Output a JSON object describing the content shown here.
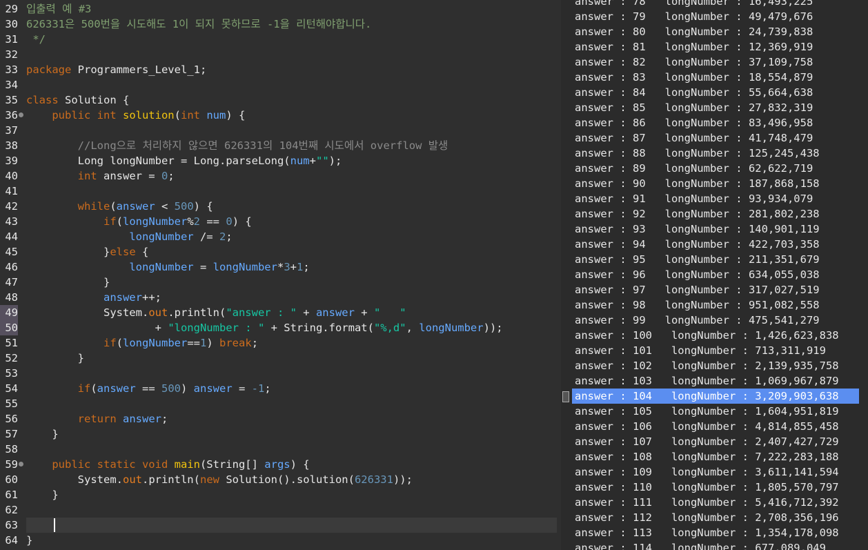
{
  "editor": {
    "lines": [
      {
        "n": "29",
        "tokens": [
          [
            "t-com",
            "입출력 예 #3"
          ]
        ]
      },
      {
        "n": "30",
        "tokens": [
          [
            "t-com",
            "626331은 500번을 시도해도 1이 되지 못하므로 -1을 리턴해야합니다."
          ]
        ]
      },
      {
        "n": "31",
        "tokens": [
          [
            "t-com",
            " */"
          ]
        ]
      },
      {
        "n": "32",
        "tokens": []
      },
      {
        "n": "33",
        "tokens": [
          [
            "t-kw",
            "package"
          ],
          [
            "t-txt",
            " Programmers_Level_1;"
          ]
        ]
      },
      {
        "n": "34",
        "tokens": []
      },
      {
        "n": "35",
        "tokens": [
          [
            "t-kw",
            "class"
          ],
          [
            "t-txt",
            " Solution {"
          ]
        ]
      },
      {
        "n": "36",
        "fold": true,
        "tokens": [
          [
            "t-txt",
            "    "
          ],
          [
            "t-kw",
            "public int "
          ],
          [
            "t-mth",
            "solution"
          ],
          [
            "t-txt",
            "("
          ],
          [
            "t-kw",
            "int "
          ],
          [
            "t-var",
            "num"
          ],
          [
            "t-txt",
            ") {"
          ]
        ]
      },
      {
        "n": "37",
        "tokens": []
      },
      {
        "n": "38",
        "tokens": [
          [
            "t-txt",
            "        "
          ],
          [
            "t-cmt",
            "//Long으로 처리하지 않으면 626331의 104번째 시도에서 overflow 발생"
          ]
        ]
      },
      {
        "n": "39",
        "tokens": [
          [
            "t-txt",
            "        Long "
          ],
          [
            "t-txt",
            "longNumber = Long."
          ],
          [
            "t-txt",
            "parseLong("
          ],
          [
            "t-var",
            "num"
          ],
          [
            "t-txt",
            "+"
          ],
          [
            "t-str",
            "\"\""
          ],
          [
            "t-txt",
            ");"
          ]
        ]
      },
      {
        "n": "40",
        "tokens": [
          [
            "t-txt",
            "        "
          ],
          [
            "t-kw",
            "int"
          ],
          [
            "t-txt",
            " answer = "
          ],
          [
            "t-num",
            "0"
          ],
          [
            "t-txt",
            ";"
          ]
        ]
      },
      {
        "n": "41",
        "tokens": []
      },
      {
        "n": "42",
        "tokens": [
          [
            "t-txt",
            "        "
          ],
          [
            "t-kw",
            "while"
          ],
          [
            "t-txt",
            "("
          ],
          [
            "t-var",
            "answer"
          ],
          [
            "t-txt",
            " < "
          ],
          [
            "t-num",
            "500"
          ],
          [
            "t-txt",
            ") {"
          ]
        ]
      },
      {
        "n": "43",
        "tokens": [
          [
            "t-txt",
            "            "
          ],
          [
            "t-kw",
            "if"
          ],
          [
            "t-txt",
            "("
          ],
          [
            "t-var",
            "longNumber"
          ],
          [
            "t-txt",
            "%"
          ],
          [
            "t-num",
            "2"
          ],
          [
            "t-txt",
            " == "
          ],
          [
            "t-num",
            "0"
          ],
          [
            "t-txt",
            ") {"
          ]
        ]
      },
      {
        "n": "44",
        "tokens": [
          [
            "t-txt",
            "                "
          ],
          [
            "t-var",
            "longNumber"
          ],
          [
            "t-txt",
            " /= "
          ],
          [
            "t-num",
            "2"
          ],
          [
            "t-txt",
            ";"
          ]
        ]
      },
      {
        "n": "45",
        "tokens": [
          [
            "t-txt",
            "            }"
          ],
          [
            "t-kw",
            "else"
          ],
          [
            "t-txt",
            " {"
          ]
        ]
      },
      {
        "n": "46",
        "tokens": [
          [
            "t-txt",
            "                "
          ],
          [
            "t-var",
            "longNumber"
          ],
          [
            "t-txt",
            " = "
          ],
          [
            "t-var",
            "longNumber"
          ],
          [
            "t-txt",
            "*"
          ],
          [
            "t-num",
            "3"
          ],
          [
            "t-txt",
            "+"
          ],
          [
            "t-num",
            "1"
          ],
          [
            "t-txt",
            ";"
          ]
        ]
      },
      {
        "n": "47",
        "tokens": [
          [
            "t-txt",
            "            }"
          ]
        ]
      },
      {
        "n": "48",
        "tokens": [
          [
            "t-txt",
            "            "
          ],
          [
            "t-var",
            "answer"
          ],
          [
            "t-txt",
            "++;"
          ]
        ]
      },
      {
        "n": "49",
        "marked": true,
        "tokens": [
          [
            "t-txt",
            "            System."
          ],
          [
            "t-fld",
            "out"
          ],
          [
            "t-txt",
            ".println("
          ],
          [
            "t-str",
            "\"answer : \""
          ],
          [
            "t-txt",
            " + "
          ],
          [
            "t-var",
            "answer"
          ],
          [
            "t-txt",
            " + "
          ],
          [
            "t-str",
            "\"   \""
          ]
        ]
      },
      {
        "n": "50",
        "marked": true,
        "tokens": [
          [
            "t-txt",
            "                    + "
          ],
          [
            "t-str",
            "\"longNumber : \""
          ],
          [
            "t-txt",
            " + String.format("
          ],
          [
            "t-str",
            "\"%,d\""
          ],
          [
            "t-txt",
            ", "
          ],
          [
            "t-var",
            "longNumber"
          ],
          [
            "t-txt",
            "));"
          ]
        ]
      },
      {
        "n": "51",
        "tokens": [
          [
            "t-txt",
            "            "
          ],
          [
            "t-kw",
            "if"
          ],
          [
            "t-txt",
            "("
          ],
          [
            "t-var",
            "longNumber"
          ],
          [
            "t-txt",
            "=="
          ],
          [
            "t-num",
            "1"
          ],
          [
            "t-txt",
            ") "
          ],
          [
            "t-kw",
            "break"
          ],
          [
            "t-txt",
            ";"
          ]
        ]
      },
      {
        "n": "52",
        "tokens": [
          [
            "t-txt",
            "        }"
          ]
        ]
      },
      {
        "n": "53",
        "tokens": []
      },
      {
        "n": "54",
        "tokens": [
          [
            "t-txt",
            "        "
          ],
          [
            "t-kw",
            "if"
          ],
          [
            "t-txt",
            "("
          ],
          [
            "t-var",
            "answer"
          ],
          [
            "t-txt",
            " == "
          ],
          [
            "t-num",
            "500"
          ],
          [
            "t-txt",
            ") "
          ],
          [
            "t-var",
            "answer"
          ],
          [
            "t-txt",
            " = "
          ],
          [
            "t-num",
            "-1"
          ],
          [
            "t-txt",
            ";"
          ]
        ]
      },
      {
        "n": "55",
        "tokens": []
      },
      {
        "n": "56",
        "tokens": [
          [
            "t-txt",
            "        "
          ],
          [
            "t-kw",
            "return"
          ],
          [
            "t-txt",
            " "
          ],
          [
            "t-var",
            "answer"
          ],
          [
            "t-txt",
            ";"
          ]
        ]
      },
      {
        "n": "57",
        "tokens": [
          [
            "t-txt",
            "    }"
          ]
        ]
      },
      {
        "n": "58",
        "tokens": []
      },
      {
        "n": "59",
        "fold": true,
        "tokens": [
          [
            "t-txt",
            "    "
          ],
          [
            "t-kw",
            "public static void "
          ],
          [
            "t-mth",
            "main"
          ],
          [
            "t-txt",
            "(String[] "
          ],
          [
            "t-var",
            "args"
          ],
          [
            "t-txt",
            ") {"
          ]
        ]
      },
      {
        "n": "60",
        "tokens": [
          [
            "t-txt",
            "        System."
          ],
          [
            "t-fld",
            "out"
          ],
          [
            "t-txt",
            ".println("
          ],
          [
            "t-kw",
            "new"
          ],
          [
            "t-txt",
            " Solution().solution("
          ],
          [
            "t-num",
            "626331"
          ],
          [
            "t-txt",
            "));"
          ]
        ]
      },
      {
        "n": "61",
        "tokens": [
          [
            "t-txt",
            "    }"
          ]
        ]
      },
      {
        "n": "62",
        "tokens": []
      },
      {
        "n": "63",
        "tokens": []
      },
      {
        "n": "64",
        "tokens": [
          [
            "t-txt",
            "}"
          ]
        ]
      }
    ]
  },
  "console": {
    "selected_index": 26,
    "lines": [
      "answer : 78   longNumber : 16,493,225",
      "answer : 79   longNumber : 49,479,676",
      "answer : 80   longNumber : 24,739,838",
      "answer : 81   longNumber : 12,369,919",
      "answer : 82   longNumber : 37,109,758",
      "answer : 83   longNumber : 18,554,879",
      "answer : 84   longNumber : 55,664,638",
      "answer : 85   longNumber : 27,832,319",
      "answer : 86   longNumber : 83,496,958",
      "answer : 87   longNumber : 41,748,479",
      "answer : 88   longNumber : 125,245,438",
      "answer : 89   longNumber : 62,622,719",
      "answer : 90   longNumber : 187,868,158",
      "answer : 91   longNumber : 93,934,079",
      "answer : 92   longNumber : 281,802,238",
      "answer : 93   longNumber : 140,901,119",
      "answer : 94   longNumber : 422,703,358",
      "answer : 95   longNumber : 211,351,679",
      "answer : 96   longNumber : 634,055,038",
      "answer : 97   longNumber : 317,027,519",
      "answer : 98   longNumber : 951,082,558",
      "answer : 99   longNumber : 475,541,279",
      "answer : 100   longNumber : 1,426,623,838",
      "answer : 101   longNumber : 713,311,919",
      "answer : 102   longNumber : 2,139,935,758",
      "answer : 103   longNumber : 1,069,967,879",
      "answer : 104   longNumber : 3,209,903,638",
      "answer : 105   longNumber : 1,604,951,819",
      "answer : 106   longNumber : 4,814,855,458",
      "answer : 107   longNumber : 2,407,427,729",
      "answer : 108   longNumber : 7,222,283,188",
      "answer : 109   longNumber : 3,611,141,594",
      "answer : 110   longNumber : 1,805,570,797",
      "answer : 111   longNumber : 5,416,712,392",
      "answer : 112   longNumber : 2,708,356,196",
      "answer : 113   longNumber : 1,354,178,098",
      "answer : 114   longNumber : 677,089,049"
    ]
  }
}
